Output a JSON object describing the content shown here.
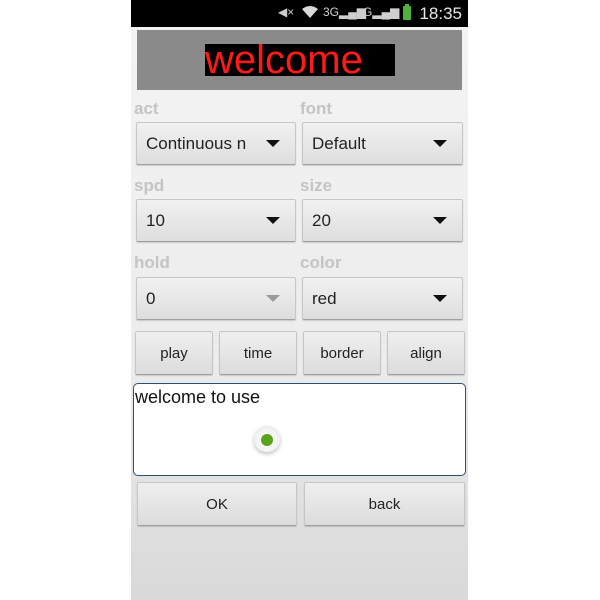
{
  "status_bar": {
    "time": "18:35",
    "icons": [
      "mute-icon",
      "wifi-icon",
      "3g-signal-icon",
      "gsm-signal-icon",
      "battery-icon"
    ],
    "network_label_1": "3G",
    "network_label_2": "G"
  },
  "banner": {
    "preview_text": "welcome",
    "text_color": "#ff1a1a",
    "background": "#000000"
  },
  "settings": {
    "act": {
      "label": "act",
      "value": "Continuous n"
    },
    "font": {
      "label": "font",
      "value": "Default"
    },
    "spd": {
      "label": "spd",
      "value": "10"
    },
    "size": {
      "label": "size",
      "value": "20"
    },
    "hold": {
      "label": "hold",
      "value": "0",
      "disabled": true
    },
    "color": {
      "label": "color",
      "value": "red"
    }
  },
  "buttons": {
    "play": "play",
    "time": "time",
    "border": "border",
    "align": "align",
    "ok": "OK",
    "back": "back"
  },
  "message_input": {
    "value": "welcome to use"
  }
}
